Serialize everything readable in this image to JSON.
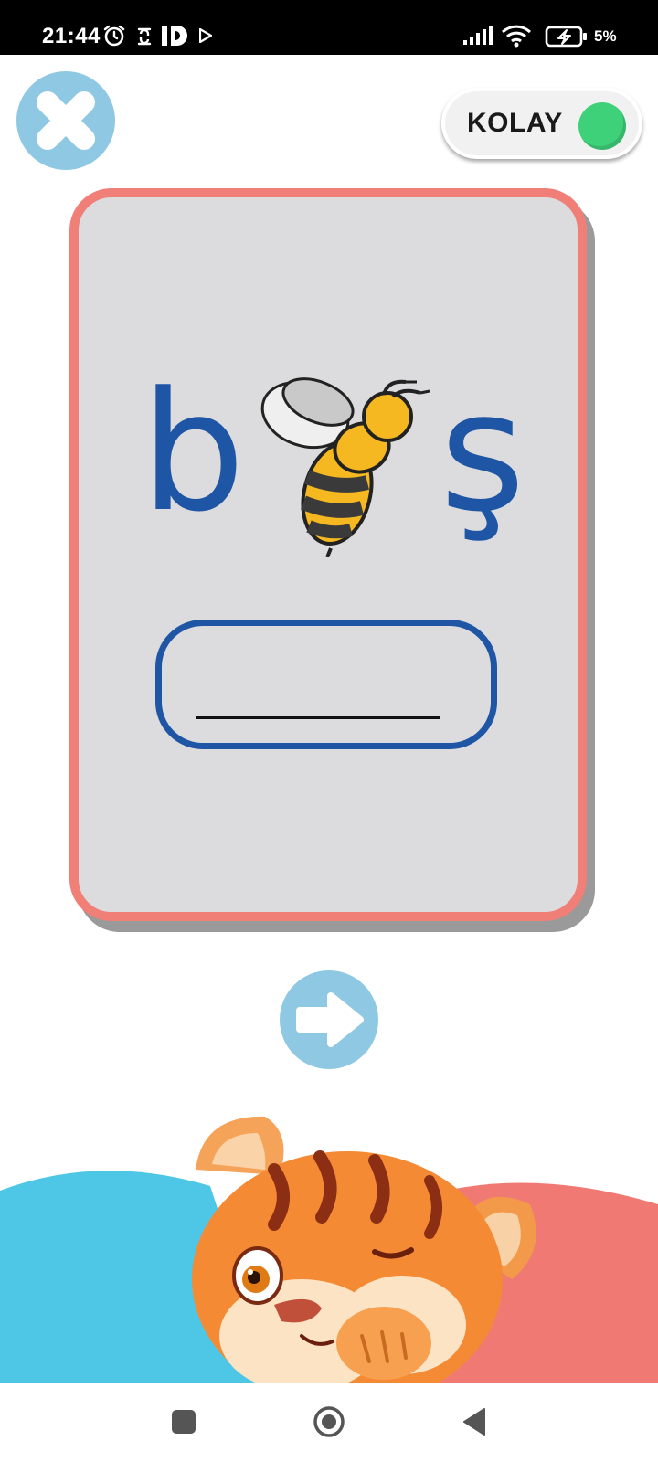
{
  "status_bar": {
    "time": "21:44",
    "battery_percent": "5%",
    "icons": [
      "alarm-icon",
      "sync-icon",
      "id-app-icon",
      "play-store-icon",
      "signal-icon",
      "wifi-icon",
      "battery-charging-icon"
    ]
  },
  "controls": {
    "close_icon": "close-icon",
    "difficulty_label": "KOLAY",
    "difficulty_color": "#3fd17a",
    "next_icon": "arrow-right-icon",
    "button_color": "#8ec8e2"
  },
  "card": {
    "letters": [
      "b",
      "ş"
    ],
    "picture": "bee-icon",
    "answer_value": "",
    "border_color": "#f07f77",
    "text_color": "#1e55a5"
  },
  "decoration": {
    "mascot": "tiger-mascot",
    "colors": [
      "#4ec6e6",
      "#f07a73"
    ]
  },
  "nav_bar": {
    "icons": [
      "square-icon",
      "circle-home-icon",
      "back-triangle-icon"
    ]
  }
}
